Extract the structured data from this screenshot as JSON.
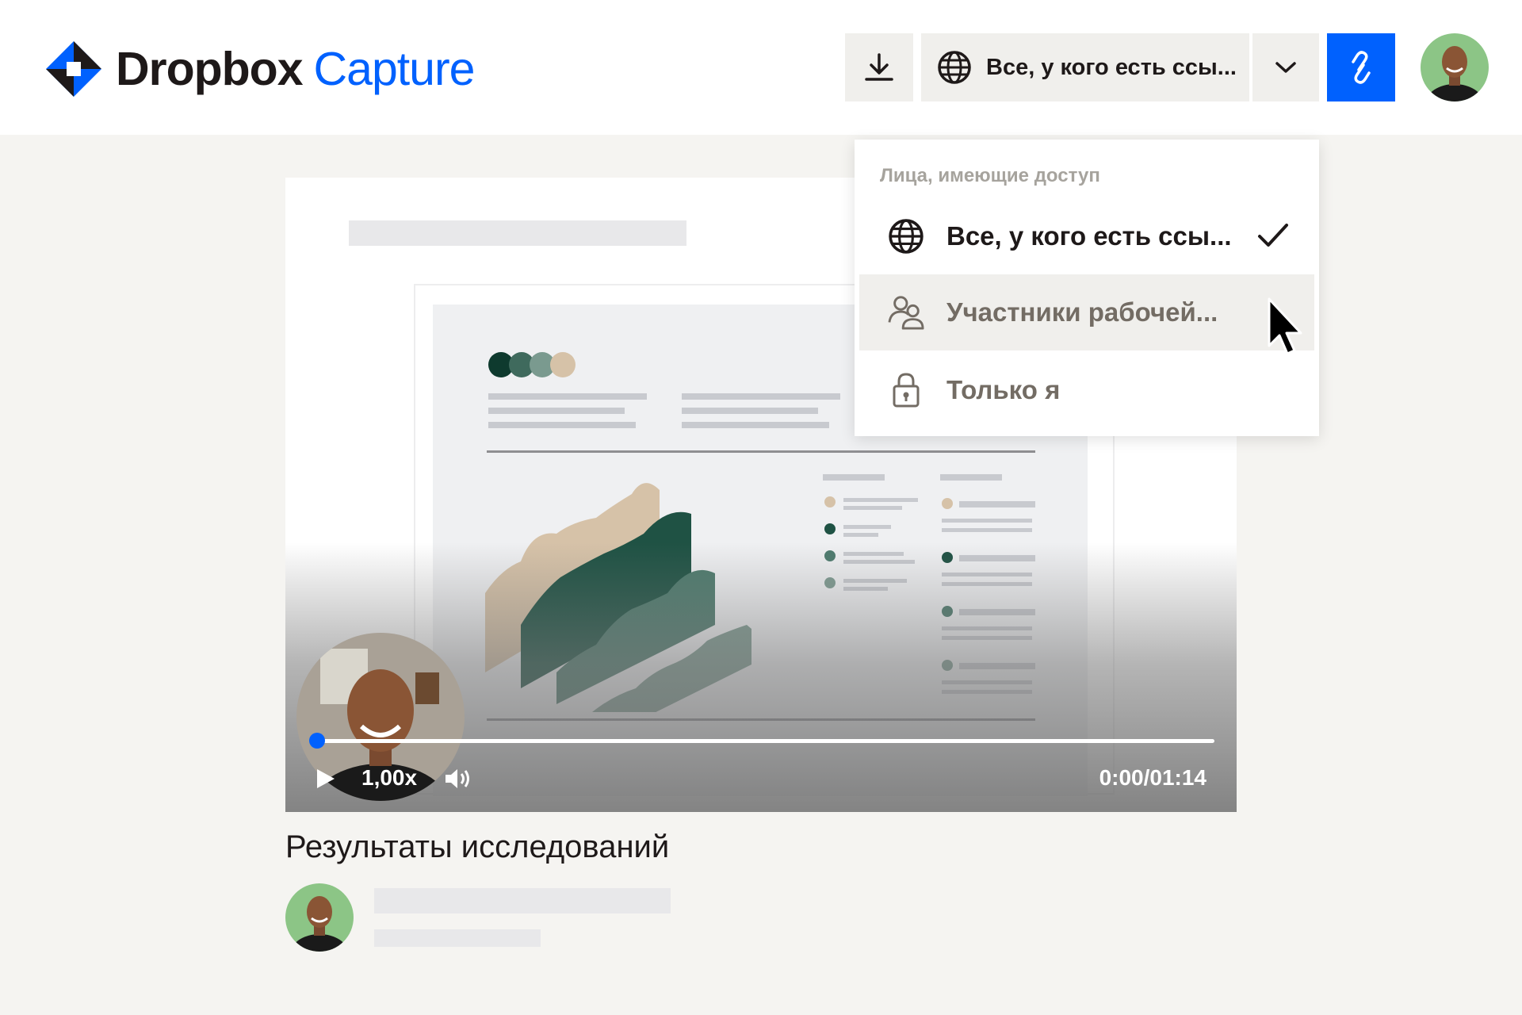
{
  "app": {
    "brand_primary": "Dropbox",
    "brand_secondary": "Capture",
    "accent_color": "#0061fe"
  },
  "toolbar": {
    "download_icon": "download-icon",
    "share_scope_label": "Все, у кого есть ссы...",
    "share_scope_icon": "globe-icon",
    "caret_icon": "chevron-down-icon",
    "copy_link_icon": "link-icon"
  },
  "share_menu": {
    "header": "Лица, имеющие доступ",
    "items": [
      {
        "label": "Все, у кого есть ссы...",
        "icon": "globe-icon",
        "selected": true
      },
      {
        "label": "Участники рабочей...",
        "icon": "people-icon",
        "selected": false,
        "hovered": true
      },
      {
        "label": "Только я",
        "icon": "lock-icon",
        "selected": false
      }
    ]
  },
  "video": {
    "speed": "1,00x",
    "time": "0:00/01:14",
    "progress": 0.0,
    "title": "Результаты исследований"
  }
}
